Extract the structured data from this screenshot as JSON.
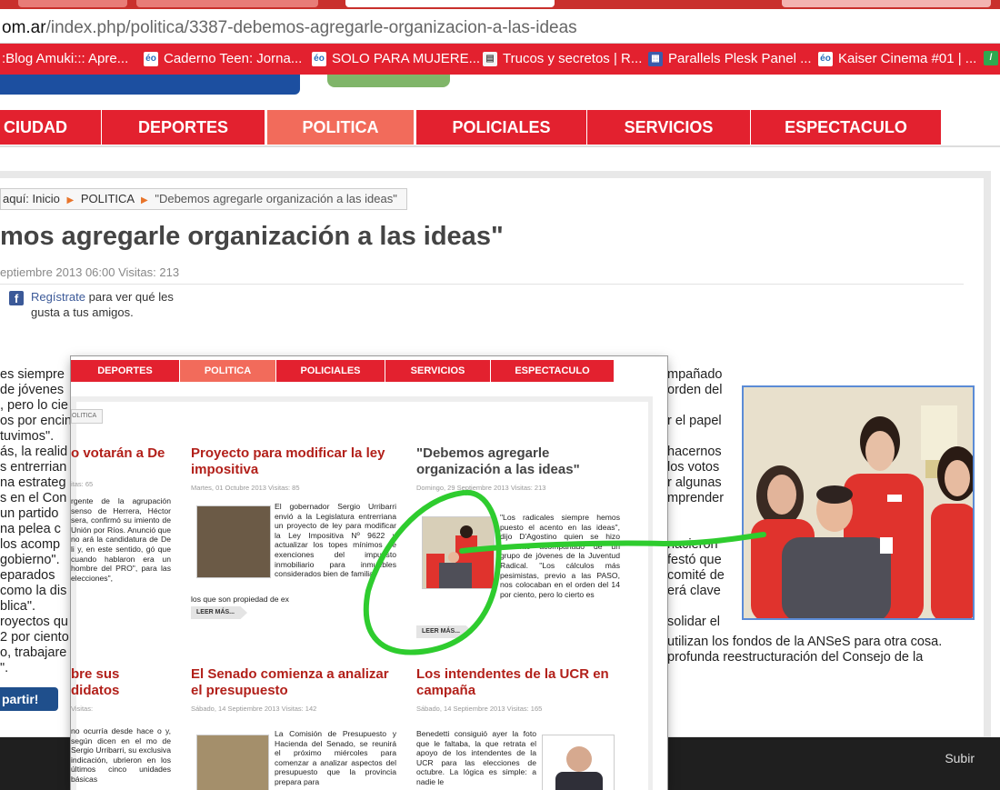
{
  "browser": {
    "url_host": "om.ar",
    "url_path": "/index.php/politica/3387-debemos-agregarle-organizacion-a-las-ideas",
    "bookmarks": [
      {
        "label": ":Blog Amuki::: Apre...",
        "icon": "blog-icon"
      },
      {
        "label": "Caderno Teen: Jorna...",
        "icon": "eo-icon"
      },
      {
        "label": "SOLO PARA MUJERE...",
        "icon": "eo-icon"
      },
      {
        "label": "Trucos y secretos | R...",
        "icon": "document-icon"
      },
      {
        "label": "Parallels Plesk Panel ...",
        "icon": "grid-icon"
      },
      {
        "label": "Kaiser Cinema #01 | ...",
        "icon": "eo-icon"
      }
    ]
  },
  "site": {
    "nav": [
      "CIUDAD",
      "DEPORTES",
      "POLITICA",
      "POLICIALES",
      "SERVICIOS",
      "ESPECTACULO"
    ],
    "active_nav": "POLITICA",
    "accent": "#e3212f",
    "breadcrumb": {
      "prefix": "aquí:",
      "items": [
        "Inicio",
        "POLITICA",
        "\"Debemos agregarle organización a las ideas\""
      ]
    },
    "headline": "mos agregarle organización a las ideas\"",
    "meta": "eptiembre 2013 06:00   Visitas: 213",
    "fb": {
      "link": "Regístrate",
      "rest": "para ver qué les gusta a tus amigos."
    },
    "body_left": [
      "es siempre",
      "de jóvenes",
      ", pero lo cie",
      "os por encin",
      " tuvimos\".",
      "ás, la realid",
      "s entrerrian",
      "na estrateg",
      "s en el Con",
      " un partido",
      "na pelea c",
      "los acomp",
      "gobierno\".",
      "eparados",
      " como la dis",
      "blica\".",
      "royectos qu",
      "2 por ciento",
      "o, trabajare",
      "\"."
    ],
    "body_right": [
      "mpañado",
      "orden del",
      "",
      "r el papel",
      "",
      "hacernos",
      "los votos",
      "r algunas",
      "mprender",
      "",
      "",
      "nacieron",
      "festó que",
      "comité de",
      "erá clave",
      "",
      "solidar el"
    ],
    "body_tail": [
      "utilizan los fondos de la ANSeS para otra cosa.",
      "profunda reestructuración del Consejo de la"
    ],
    "share": "partir!",
    "subir": "Subir"
  },
  "inset": {
    "nav": [
      "DEPORTES",
      "POLITICA",
      "POLICIALES",
      "SERVICIOS",
      "ESPECTACULO"
    ],
    "active_nav": "POLITICA",
    "crumb": "OLITICA",
    "articles": [
      {
        "title": "o votarán a De",
        "meta": "itas: 65",
        "body": "rgente de la agrupación senso de Herrera, Héctor sera, confirmó su imiento de Unión por Ríos. Anunció que no ará la candidatura de De li y, en este sentido, gó que cuando hablaron era un hombre del PRO\", para las elecciones\","
      },
      {
        "title": "Proyecto para modificar la ley impositiva",
        "meta": "Martes, 01 Octubre 2013   Visitas: 85",
        "body": "El gobernador Sergio Urribarri envió a la Legislatura entrerriana un proyecto de ley para modificar la Ley Impositiva Nº 9622 y actualizar los topes mínimos de exenciones del impuesto inmobiliario para inmuebles considerados bien de familia,",
        "tail": "los que son propiedad de ex",
        "more": "LEER MÁS..."
      },
      {
        "title": "\"Debemos agregarle organización a las ideas\"",
        "meta": "Domingo, 29 Septiembre 2013   Visitas: 213",
        "body": "\"Los radicales siempre hemos puesto el acento en las ideas\", dijo D'Agostino quien se hizo presente acompañado de un grupo de jóvenes de la Juventud Radical. \"Los cálculos más pesimistas, previo a las PASO, nos colocaban en el orden del 14 por ciento, pero lo cierto es",
        "more": "LEER MÁS..."
      },
      {
        "title": "bre sus didatos",
        "meta": "Visitas:",
        "body": "no ocurría desde hace o y, según dicen en el mo de Sergio Urribarri, su exclusiva indicación, ubrieron en los últimos cinco unidades básicas"
      },
      {
        "title": "El Senado comienza a analizar el presupuesto",
        "meta": "Sábado, 14 Septiembre 2013   Visitas: 142",
        "body": "La Comisión de Presupuesto y Hacienda del Senado, se reunirá el próximo miércoles para comenzar a analizar aspectos del presupuesto que la provincia prepara para"
      },
      {
        "title": "Los intendentes de la UCR en campaña",
        "meta": "Sábado, 14 Septiembre 2013   Visitas: 165",
        "body": "Benedetti consiguió ayer la foto que le faltaba, la que retrata el apoyo de los intendentes de la UCR para las elecciones de octubre. La lógica es simple: a nadie le"
      }
    ]
  },
  "annotation_color": "#2ecc2e"
}
